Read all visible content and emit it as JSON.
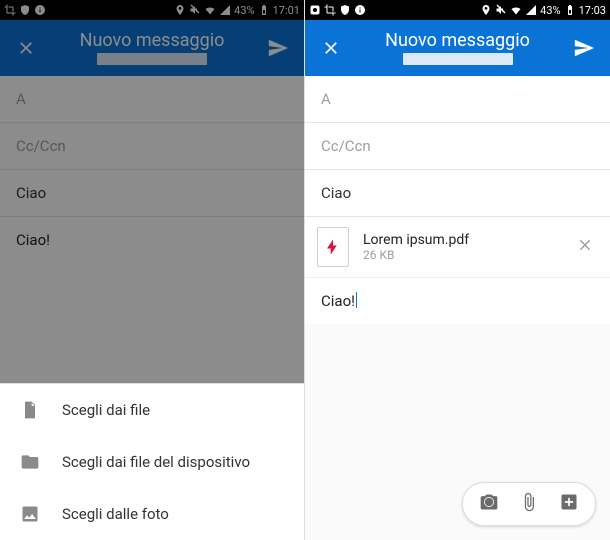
{
  "left": {
    "status": {
      "battery": "43%",
      "time": "17:01"
    },
    "appbar": {
      "title": "Nuovo messaggio"
    },
    "fields": {
      "to_label": "A",
      "cc_label": "Cc/Ccn",
      "subject": "Ciao",
      "body": "Ciao!"
    },
    "sheet": {
      "items": [
        {
          "label": "Scegli dai file"
        },
        {
          "label": "Scegli dai file del dispositivo"
        },
        {
          "label": "Scegli dalle foto"
        }
      ]
    }
  },
  "right": {
    "status": {
      "battery": "43%",
      "time": "17:03"
    },
    "appbar": {
      "title": "Nuovo messaggio"
    },
    "fields": {
      "to_label": "A",
      "cc_label": "Cc/Ccn",
      "subject": "Ciao",
      "body": "Ciao!"
    },
    "attachment": {
      "name": "Lorem ipsum.pdf",
      "size": "26 KB"
    }
  }
}
